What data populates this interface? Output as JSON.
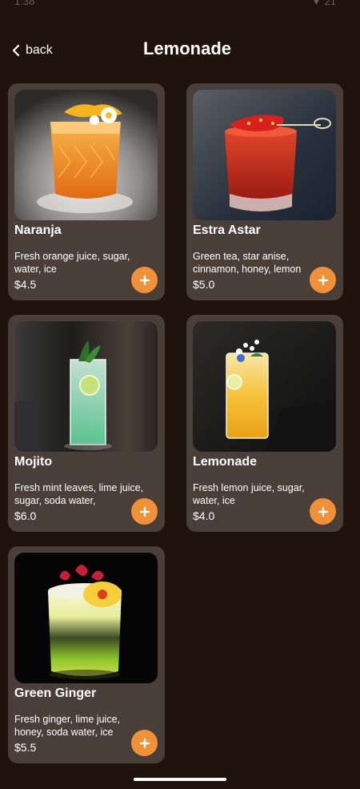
{
  "status_bar": {
    "time": "1:38",
    "signal": "▼ 21"
  },
  "header": {
    "back_label": "back",
    "title": "Lemonade"
  },
  "products": [
    {
      "name": "Naranja",
      "description": "Fresh orange juice, sugar, water, ice",
      "price": "$4.5",
      "image_icon": "orange-cocktail-icon",
      "drink_color": "#f0912a"
    },
    {
      "name": "Estra Astar",
      "description": "Green tea, star anise, cinnamon, honey, lemon",
      "price": "$5.0",
      "image_icon": "strawberry-cocktail-icon",
      "drink_color": "#c0281a"
    },
    {
      "name": "Mojito",
      "description": "Fresh mint leaves, lime juice, sugar, soda water,",
      "price": "$6.0",
      "image_icon": "mojito-icon",
      "drink_color": "#8fe0b8"
    },
    {
      "name": "Lemonade",
      "description": "Fresh lemon juice, sugar, water, ice",
      "price": "$4.0",
      "image_icon": "lemonade-icon",
      "drink_color": "#f3c03a"
    },
    {
      "name": "Green Ginger",
      "description": "Fresh ginger, lime juice, honey, soda water, ice",
      "price": "$5.5",
      "image_icon": "green-ginger-icon",
      "drink_color": "#b5cc2e"
    }
  ],
  "colors": {
    "background": "#1f120a",
    "card": "#4a3f38",
    "accent": "#f0913a"
  }
}
